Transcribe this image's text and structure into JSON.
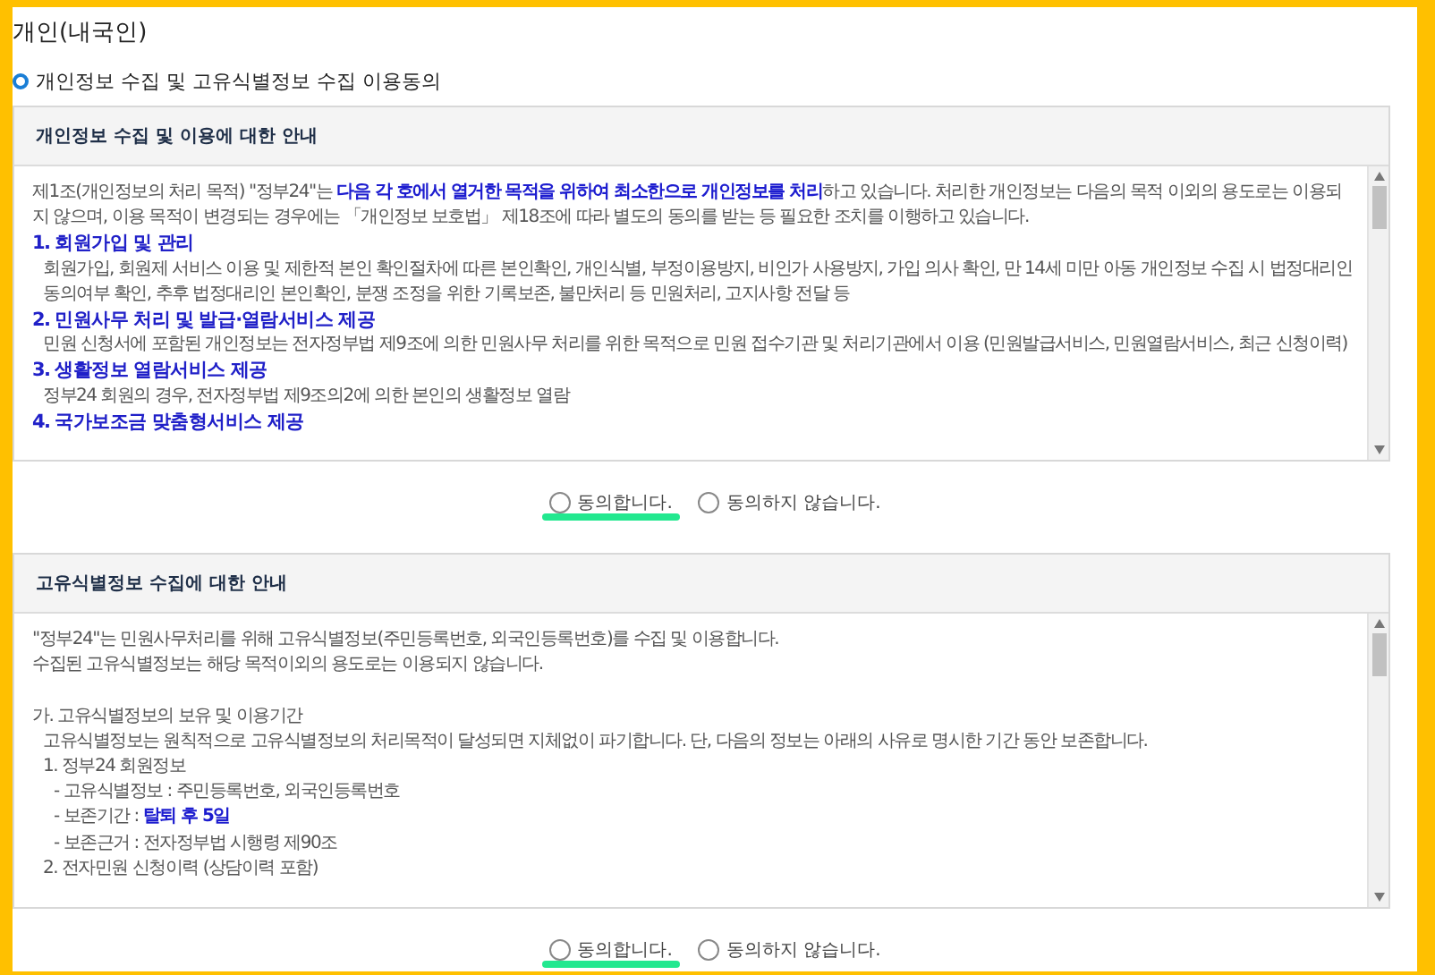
{
  "page": {
    "title": "개인(내국인)",
    "section_heading": "개인정보 수집 및 고유식별정보 수집 이용동의"
  },
  "notices": [
    {
      "title": "개인정보 수집 및 이용에 대한 안내",
      "lines": [
        {
          "kind": "para",
          "text": "제1조(개인정보의 처리 목적) \"정부24\"는 **다음 각 호에서 열거한 목적을 위하여 최소한으로 개인정보를 처리**하고 있습니다. 처리한 개인정보는 다음의 목적 이외의 용도로는 이용되지 않으며, 이용 목적이 변경되는 경우에는 「개인정보 보호법」 제18조에 따라 별도의 동의를 받는 등 필요한 조치를 이행하고 있습니다."
        },
        {
          "kind": "heading",
          "text": "1. 회원가입 및 관리"
        },
        {
          "kind": "detail",
          "text": "회원가입, 회원제 서비스 이용 및 제한적 본인 확인절차에 따른 본인확인, 개인식별, 부정이용방지, 비인가 사용방지, 가입 의사 확인, 만 14세 미만 아동 개인정보 수집 시 법정대리인 동의여부 확인, 추후 법정대리인 본인확인, 분쟁 조정을 위한 기록보존, 불만처리 등 민원처리, 고지사항 전달 등"
        },
        {
          "kind": "heading",
          "text": "2. 민원사무 처리 및 발급·열람서비스 제공"
        },
        {
          "kind": "detail",
          "text": "민원 신청서에 포함된 개인정보는 전자정부법 제9조에 의한 민원사무 처리를 위한 목적으로 민원 접수기관 및 처리기관에서 이용 (민원발급서비스, 민원열람서비스, 최근 신청이력)"
        },
        {
          "kind": "heading",
          "text": "3. 생활정보 열람서비스 제공"
        },
        {
          "kind": "detail",
          "text": "정부24 회원의 경우, 전자정부법 제9조의2에 의한 본인의 생활정보 열람"
        },
        {
          "kind": "heading",
          "text": "4. 국가보조금 맞춤형서비스 제공"
        }
      ],
      "options": [
        {
          "label": "동의합니다.",
          "selected": false,
          "highlighted": true
        },
        {
          "label": "동의하지 않습니다.",
          "selected": false,
          "highlighted": false
        }
      ]
    },
    {
      "title": "고유식별정보 수집에 대한 안내",
      "lines": [
        {
          "kind": "para",
          "text": "\"정부24\"는 민원사무처리를 위해 고유식별정보(주민등록번호, 외국인등록번호)를 수집 및 이용합니다."
        },
        {
          "kind": "para",
          "text": "수집된 고유식별정보는 해당 목적이외의 용도로는 이용되지 않습니다."
        },
        {
          "kind": "gap"
        },
        {
          "kind": "para",
          "text": "가. 고유식별정보의 보유 및 이용기간"
        },
        {
          "kind": "detail",
          "text": "고유식별정보는 원칙적으로 고유식별정보의 처리목적이 달성되면 지체없이 파기합니다. 단, 다음의 정보는 아래의 사유로 명시한 기간 동안 보존합니다."
        },
        {
          "kind": "detail",
          "text": "1. 정부24 회원정보"
        },
        {
          "kind": "item",
          "text": "- 고유식별정보 : 주민등록번호, 외국인등록번호"
        },
        {
          "kind": "item",
          "text": "- 보존기간 : **탈퇴 후 5일**"
        },
        {
          "kind": "item",
          "text": "- 보존근거 : 전자정부법 시행령 제90조"
        },
        {
          "kind": "detail",
          "text": "2. 전자민원 신청이력 (상담이력 포함)"
        }
      ],
      "options": [
        {
          "label": "동의합니다.",
          "selected": false,
          "highlighted": true
        },
        {
          "label": "동의하지 않습니다.",
          "selected": false,
          "highlighted": false
        }
      ]
    }
  ]
}
